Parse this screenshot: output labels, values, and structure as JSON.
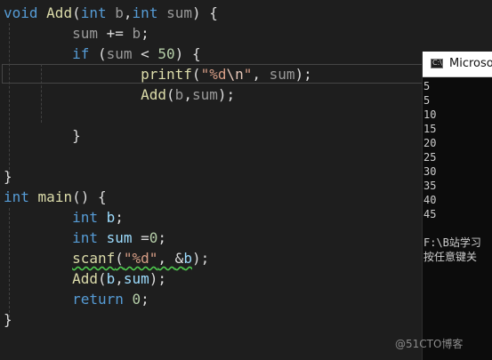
{
  "editor": {
    "lines": [
      {
        "tokens": [
          {
            "t": "void",
            "c": "kw"
          },
          {
            "t": " ",
            "c": ""
          },
          {
            "t": "Add",
            "c": "fn"
          },
          {
            "t": "(",
            "c": ""
          },
          {
            "t": "int",
            "c": "kw"
          },
          {
            "t": " ",
            "c": ""
          },
          {
            "t": "b",
            "c": "param"
          },
          {
            "t": ",",
            "c": ""
          },
          {
            "t": "int",
            "c": "kw"
          },
          {
            "t": " ",
            "c": ""
          },
          {
            "t": "sum",
            "c": "param"
          },
          {
            "t": ") {",
            "c": ""
          }
        ]
      },
      {
        "tokens": [
          {
            "t": "        ",
            "c": ""
          },
          {
            "t": "sum",
            "c": "param"
          },
          {
            "t": " += ",
            "c": ""
          },
          {
            "t": "b",
            "c": "param"
          },
          {
            "t": ";",
            "c": ""
          }
        ]
      },
      {
        "tokens": [
          {
            "t": "        ",
            "c": ""
          },
          {
            "t": "if",
            "c": "kw"
          },
          {
            "t": " (",
            "c": ""
          },
          {
            "t": "sum",
            "c": "param"
          },
          {
            "t": " < ",
            "c": ""
          },
          {
            "t": "50",
            "c": "num"
          },
          {
            "t": ") {",
            "c": ""
          }
        ]
      },
      {
        "tokens": [
          {
            "t": "                ",
            "c": ""
          },
          {
            "t": "printf",
            "c": "fn"
          },
          {
            "t": "(",
            "c": ""
          },
          {
            "t": "\"%d",
            "c": "str"
          },
          {
            "t": "\\n",
            "c": "esc"
          },
          {
            "t": "\"",
            "c": "str"
          },
          {
            "t": ", ",
            "c": ""
          },
          {
            "t": "sum",
            "c": "param"
          },
          {
            "t": ");",
            "c": ""
          }
        ]
      },
      {
        "tokens": [
          {
            "t": "                ",
            "c": ""
          },
          {
            "t": "Add",
            "c": "fn"
          },
          {
            "t": "(",
            "c": ""
          },
          {
            "t": "b",
            "c": "param"
          },
          {
            "t": ",",
            "c": ""
          },
          {
            "t": "sum",
            "c": "param"
          },
          {
            "t": ");",
            "c": ""
          }
        ]
      },
      {
        "tokens": []
      },
      {
        "tokens": [
          {
            "t": "        }",
            "c": ""
          }
        ]
      },
      {
        "tokens": []
      },
      {
        "tokens": [
          {
            "t": "}",
            "c": ""
          }
        ]
      },
      {
        "tokens": [
          {
            "t": "int",
            "c": "kw"
          },
          {
            "t": " ",
            "c": ""
          },
          {
            "t": "main",
            "c": "fn"
          },
          {
            "t": "() {",
            "c": ""
          }
        ]
      },
      {
        "tokens": [
          {
            "t": "        ",
            "c": ""
          },
          {
            "t": "int",
            "c": "kw"
          },
          {
            "t": " ",
            "c": ""
          },
          {
            "t": "b",
            "c": "var"
          },
          {
            "t": ";",
            "c": ""
          }
        ]
      },
      {
        "tokens": [
          {
            "t": "        ",
            "c": ""
          },
          {
            "t": "int",
            "c": "kw"
          },
          {
            "t": " ",
            "c": ""
          },
          {
            "t": "sum",
            "c": "var"
          },
          {
            "t": " =",
            "c": ""
          },
          {
            "t": "0",
            "c": "num"
          },
          {
            "t": ";",
            "c": ""
          }
        ]
      },
      {
        "tokens": [
          {
            "t": "        ",
            "c": ""
          },
          {
            "t": "scanf",
            "c": "fn squiggle"
          },
          {
            "t": "(",
            "c": "squiggle"
          },
          {
            "t": "\"%d\"",
            "c": "str squiggle"
          },
          {
            "t": ", ",
            "c": "squiggle"
          },
          {
            "t": "&",
            "c": "squiggle"
          },
          {
            "t": "b",
            "c": "var squiggle"
          },
          {
            "t": ");",
            "c": ""
          }
        ]
      },
      {
        "tokens": [
          {
            "t": "        ",
            "c": ""
          },
          {
            "t": "Add",
            "c": "fn"
          },
          {
            "t": "(",
            "c": ""
          },
          {
            "t": "b",
            "c": "var"
          },
          {
            "t": ",",
            "c": ""
          },
          {
            "t": "sum",
            "c": "var"
          },
          {
            "t": ");",
            "c": ""
          }
        ]
      },
      {
        "tokens": [
          {
            "t": "        ",
            "c": ""
          },
          {
            "t": "return",
            "c": "kw"
          },
          {
            "t": " ",
            "c": ""
          },
          {
            "t": "0",
            "c": "num"
          },
          {
            "t": ";",
            "c": ""
          }
        ]
      },
      {
        "tokens": [
          {
            "t": "}",
            "c": ""
          }
        ]
      }
    ]
  },
  "console": {
    "title": "Microsoft Visual Studio 调试控制台",
    "output_lines": [
      "5",
      "5",
      "10",
      "15",
      "20",
      "25",
      "30",
      "35",
      "40",
      "45",
      "",
      "F:\\B站学习",
      "按任意键关"
    ]
  },
  "watermark": "@51CTO博客",
  "colors": {
    "editor_bg": "#1e1e1e",
    "console_bg": "#0c0c0c",
    "keyword": "#569cd6",
    "function": "#dcdcaa",
    "string": "#d69d85",
    "number": "#b5cea8"
  }
}
